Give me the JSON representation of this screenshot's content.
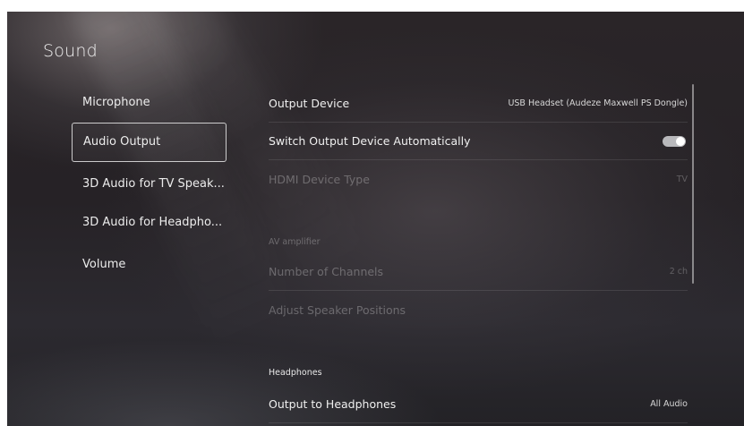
{
  "page": {
    "title": "Sound"
  },
  "sidebar": {
    "items": [
      {
        "label": "Microphone",
        "selected": false
      },
      {
        "label": "Audio Output",
        "selected": true
      },
      {
        "label": "3D Audio for TV Speak...",
        "selected": false
      },
      {
        "label": "3D Audio for Headpho...",
        "selected": false
      },
      {
        "label": "Volume",
        "selected": false
      }
    ]
  },
  "settings": {
    "output_device": {
      "label": "Output Device",
      "value": "USB Headset (Audeze Maxwell PS Dongle)"
    },
    "switch_auto": {
      "label": "Switch Output Device Automatically",
      "enabled": true
    },
    "hdmi_device_type": {
      "label": "HDMI Device Type",
      "value": "TV",
      "disabled": true
    },
    "av_amplifier_header": "AV amplifier",
    "number_of_channels": {
      "label": "Number of Channels",
      "value": "2 ch",
      "disabled": true
    },
    "adjust_speaker_positions": {
      "label": "Adjust Speaker Positions",
      "disabled": true
    },
    "headphones_header": "Headphones",
    "output_to_headphones": {
      "label": "Output to Headphones",
      "value": "All Audio"
    }
  },
  "colors": {
    "background": "#262226",
    "text": "#f0f0f0",
    "disabled_text": "#5a5658",
    "toggle_track": "#b9b9bc",
    "selection_border": "#c8c8c8"
  },
  "icons": {
    "toggle": "toggle-switch-on"
  }
}
